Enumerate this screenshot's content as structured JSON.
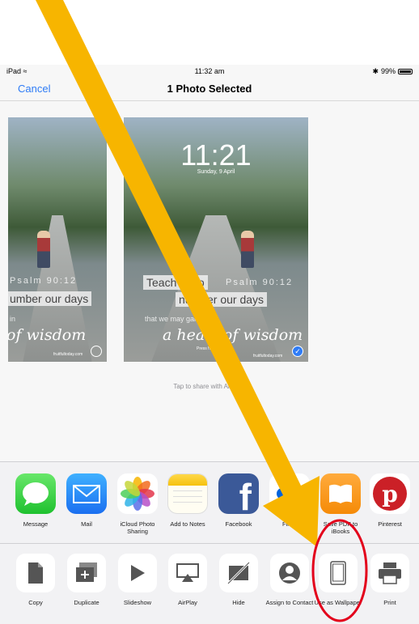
{
  "status_bar": {
    "carrier": "iPad",
    "time": "11:32 am",
    "battery": "99%"
  },
  "nav": {
    "cancel": "Cancel",
    "title": "1 Photo Selected"
  },
  "photos": [
    {
      "psalm": "Psalm 90:12",
      "line1": "umber our days",
      "line2": "in",
      "script": "of wisdom",
      "credit": "fruitfultoday.com"
    },
    {
      "time": "11:21",
      "date": "Sunday, 9 April",
      "teach": "Teach us to",
      "psalm": "Psalm 90:12",
      "line1": "number our days",
      "line2": "that we may gain",
      "script": "a heart of wisdom",
      "unlock": "Press home to open",
      "credit": "fruitfultoday.com"
    }
  ],
  "airdrop_hint": "Tap to share with AirDrop",
  "apps": [
    {
      "label": "Message"
    },
    {
      "label": "Mail"
    },
    {
      "label": "iCloud Photo Sharing"
    },
    {
      "label": "Add to Notes"
    },
    {
      "label": "Facebook"
    },
    {
      "label": "Flickr"
    },
    {
      "label": "Save PDF to iBooks"
    },
    {
      "label": "Pinterest"
    }
  ],
  "actions": [
    {
      "label": "Copy"
    },
    {
      "label": "Duplicate"
    },
    {
      "label": "Slideshow"
    },
    {
      "label": "AirPlay"
    },
    {
      "label": "Hide"
    },
    {
      "label": "Assign to Contact"
    },
    {
      "label": "Use as Wallpaper"
    },
    {
      "label": "Print"
    }
  ],
  "colors": {
    "accent": "#2f7cf6",
    "annotation_arrow": "#f7b500",
    "annotation_circle": "#e3001b"
  }
}
